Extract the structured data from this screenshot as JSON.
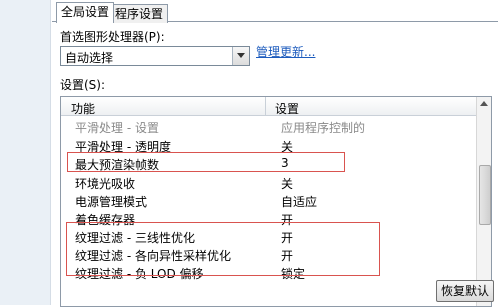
{
  "tabs": [
    "全局设置",
    "程序设置"
  ],
  "gpu": {
    "label": "首选图形处理器(P):",
    "selected": "自动选择",
    "manage_link": "管理更新..."
  },
  "settings": {
    "label": "设置(S):",
    "columns": [
      "功能",
      "设置"
    ],
    "rows": [
      {
        "feature": "平滑处理 - 设置",
        "value": "应用程序控制的"
      },
      {
        "feature": "平滑处理 - 透明度",
        "value": "关"
      },
      {
        "feature": "最大预渲染帧数",
        "value": "3"
      },
      {
        "feature": "环境光吸收",
        "value": "关"
      },
      {
        "feature": "电源管理模式",
        "value": "自适应"
      },
      {
        "feature": "着色缓存器",
        "value": "开"
      },
      {
        "feature": "纹理过滤 - 三线性优化",
        "value": "开"
      },
      {
        "feature": "纹理过滤 - 各向异性采样优化",
        "value": "开"
      },
      {
        "feature": "纹理过滤 - 负 LOD 偏移",
        "value": "锁定"
      }
    ]
  },
  "buttons": {
    "apply": "恢复默认"
  },
  "colors": {
    "highlight": "#d9534f",
    "link": "#1c5bbd"
  }
}
